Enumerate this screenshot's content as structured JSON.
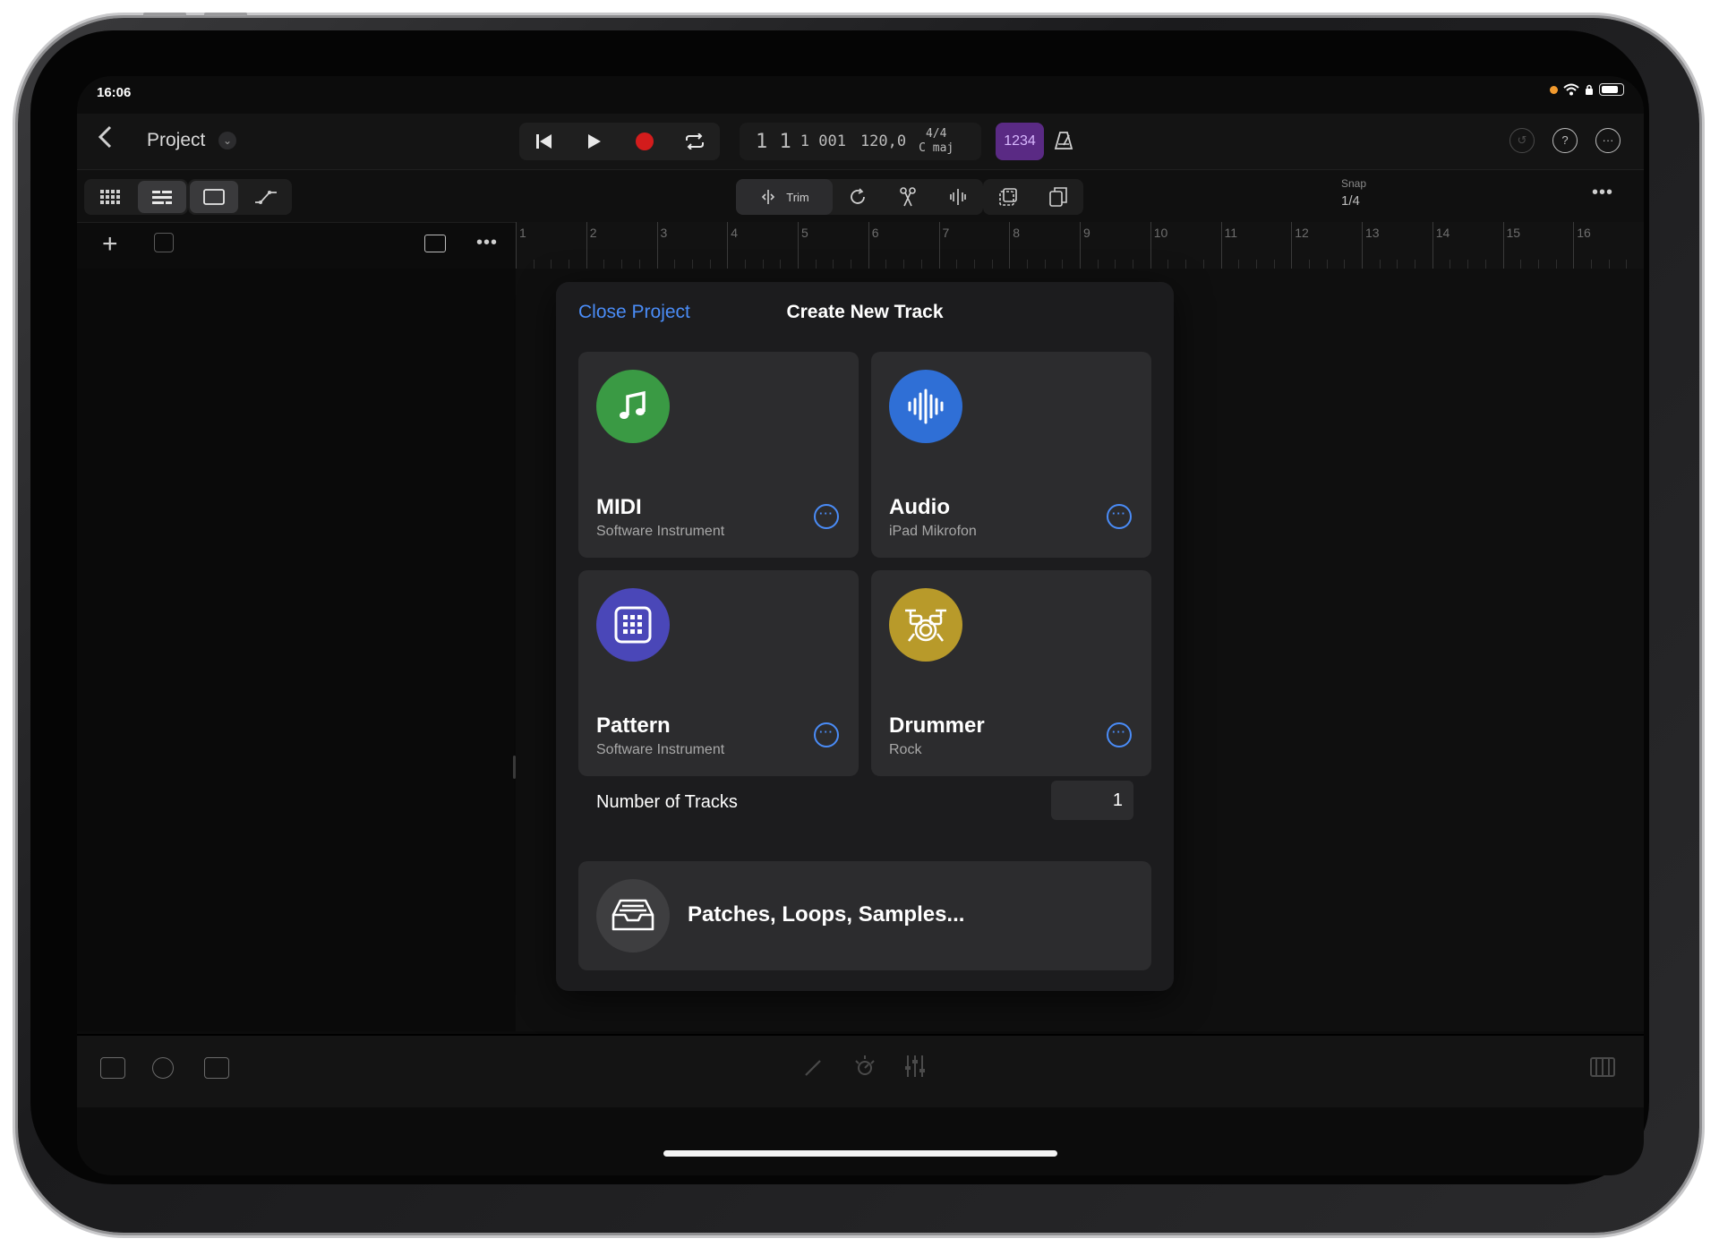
{
  "status": {
    "time": "16:06"
  },
  "header": {
    "back_icon": "chevron-left-icon",
    "project_title": "Project"
  },
  "lcd": {
    "position": "1 1",
    "ticks": "1 001",
    "tempo": "120,0",
    "signature": "4/4",
    "key": "C maj"
  },
  "count_in_label": "1234",
  "edit_tools": {
    "trim_label": "Trim"
  },
  "snap": {
    "label": "Snap",
    "value": "1/4"
  },
  "ruler": {
    "bars": [
      "1",
      "2",
      "3",
      "4",
      "5",
      "6",
      "7",
      "8",
      "9",
      "10",
      "11",
      "12",
      "13",
      "14",
      "15",
      "16"
    ]
  },
  "modal": {
    "close_label": "Close Project",
    "title": "Create New Track",
    "cards": [
      {
        "name": "MIDI",
        "subtitle": "Software Instrument",
        "icon": "music-note-icon",
        "color": "#3a9a44"
      },
      {
        "name": "Audio",
        "subtitle": "iPad Mikrofon",
        "icon": "waveform-icon",
        "color": "#2f6fd6"
      },
      {
        "name": "Pattern",
        "subtitle": "Software Instrument",
        "icon": "step-grid-icon",
        "color": "#4a47b8"
      },
      {
        "name": "Drummer",
        "subtitle": "Rock",
        "icon": "drum-kit-icon",
        "color": "#b89a2a"
      }
    ],
    "number_of_tracks_label": "Number of Tracks",
    "number_of_tracks_value": "1",
    "browser_label": "Patches, Loops, Samples..."
  },
  "colors": {
    "accent": "#4a8cf7",
    "record": "#d31c1c",
    "count_in_bg": "#5a2a84"
  }
}
